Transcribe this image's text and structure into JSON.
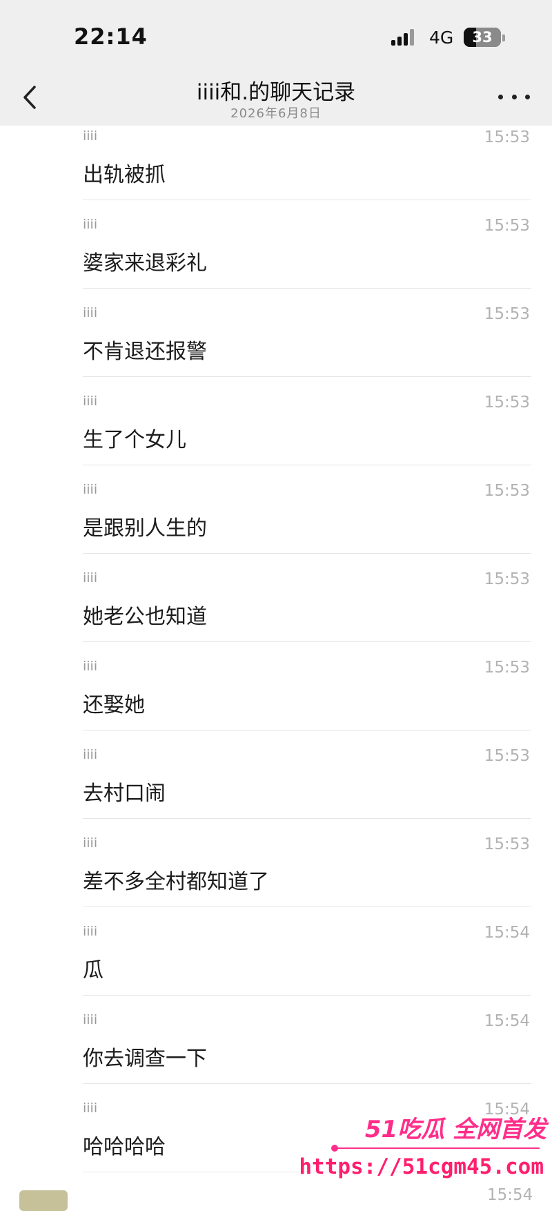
{
  "status_bar": {
    "time": "22:14",
    "network": "4G",
    "battery": "33",
    "battery_level_percent": 33
  },
  "nav": {
    "title": "iiii和.的聊天记录",
    "subtitle": "2026年6月8日"
  },
  "messages": [
    {
      "sender": "iiii",
      "time": "15:53",
      "text": "出轨被抓"
    },
    {
      "sender": "iiii",
      "time": "15:53",
      "text": "婆家来退彩礼"
    },
    {
      "sender": "iiii",
      "time": "15:53",
      "text": "不肯退还报警"
    },
    {
      "sender": "iiii",
      "time": "15:53",
      "text": "生了个女儿"
    },
    {
      "sender": "iiii",
      "time": "15:53",
      "text": "是跟别人生的"
    },
    {
      "sender": "iiii",
      "time": "15:53",
      "text": "她老公也知道"
    },
    {
      "sender": "iiii",
      "time": "15:53",
      "text": "还娶她"
    },
    {
      "sender": "iiii",
      "time": "15:53",
      "text": "去村口闹"
    },
    {
      "sender": "iiii",
      "time": "15:53",
      "text": "差不多全村都知道了"
    },
    {
      "sender": "iiii",
      "time": "15:54",
      "text": "瓜"
    },
    {
      "sender": "iiii",
      "time": "15:54",
      "text": "你去调查一下"
    },
    {
      "sender": "iiii",
      "time": "15:54",
      "text": "哈哈哈哈"
    }
  ],
  "partial_message": {
    "time": "15:54"
  },
  "watermark": {
    "brand": "51吃瓜 全网首发",
    "url": "https://51cgm45.com"
  },
  "colors": {
    "header_bg": "#efefef",
    "watermark": "#ff2d8a"
  }
}
